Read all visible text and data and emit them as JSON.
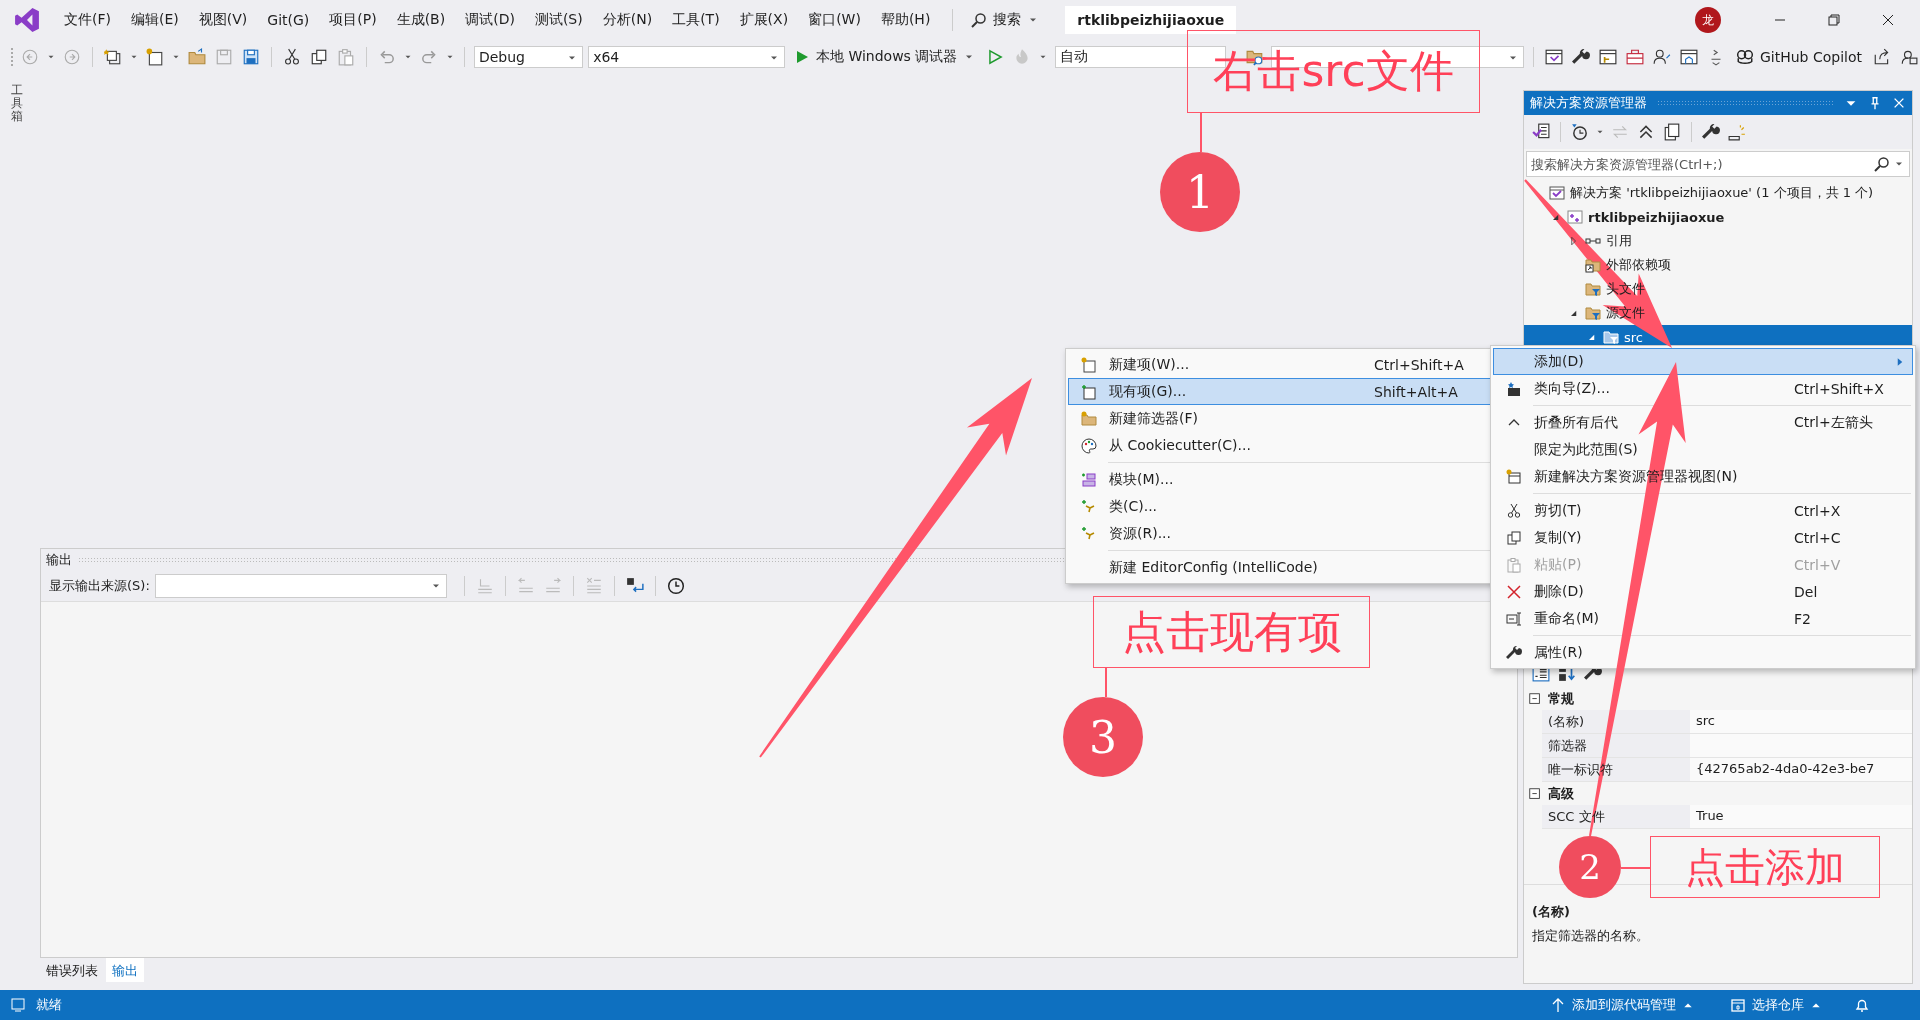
{
  "title_bar": {
    "menus": [
      "文件(F)",
      "编辑(E)",
      "视图(V)",
      "Git(G)",
      "项目(P)",
      "生成(B)",
      "调试(D)",
      "测试(S)",
      "分析(N)",
      "工具(T)",
      "扩展(X)",
      "窗口(W)",
      "帮助(H)"
    ],
    "search": "搜索",
    "solution_name": "rtklibpeizhijiaoxue",
    "avatar": "龙"
  },
  "toolbar": {
    "configuration": "Debug",
    "platform": "x64",
    "run": "本地 Windows 调试器",
    "startup": "自动",
    "copilot": "GitHub Copilot"
  },
  "side_tab": "工具箱",
  "output_panel": {
    "title": "输出",
    "source_label": "显示输出来源(S):",
    "tabs": [
      {
        "label": "错误列表",
        "selected": false
      },
      {
        "label": "输出",
        "selected": true
      }
    ]
  },
  "solution_explorer": {
    "title": "解决方案资源管理器",
    "search": {
      "placeholder": "搜索解决方案资源管理器(Ctrl+;)"
    },
    "tree": [
      {
        "label": "解决方案 'rtklibpeizhijiaoxue' (1 个项目，共 1 个)",
        "kind": "solution",
        "selected": false,
        "children": [
          {
            "label": "rtklibpeizhijiaoxue",
            "kind": "project",
            "expanded": true,
            "selected": false,
            "children": [
              {
                "label": "引用",
                "kind": "references",
                "expanded": false,
                "selected": false
              },
              {
                "label": "外部依赖项",
                "kind": "external",
                "selected": false
              },
              {
                "label": "头文件",
                "kind": "filter",
                "selected": false
              },
              {
                "label": "源文件",
                "kind": "filter",
                "expanded": true,
                "selected": false,
                "children": [
                  {
                    "label": "src",
                    "kind": "filter",
                    "expanded": true,
                    "selected": true
                  }
                ]
              }
            ]
          }
        ]
      }
    ]
  },
  "context_menu": {
    "items": [
      {
        "kind": "item",
        "label": "添加(D)",
        "submenu": true,
        "selected": true,
        "disabled": false
      },
      {
        "kind": "item",
        "label": "类向导(Z)...",
        "shortcut": "Ctrl+Shift+X",
        "selected": false,
        "disabled": false
      },
      {
        "kind": "separator"
      },
      {
        "kind": "item",
        "label": "折叠所有后代",
        "shortcut": "Ctrl+左箭头",
        "selected": false,
        "disabled": false
      },
      {
        "kind": "item",
        "label": "限定为此范围(S)",
        "selected": false,
        "disabled": false
      },
      {
        "kind": "item",
        "label": "新建解决方案资源管理器视图(N)",
        "selected": false,
        "disabled": false
      },
      {
        "kind": "separator"
      },
      {
        "kind": "item",
        "label": "剪切(T)",
        "shortcut": "Ctrl+X",
        "selected": false,
        "disabled": false
      },
      {
        "kind": "item",
        "label": "复制(Y)",
        "shortcut": "Ctrl+C",
        "selected": false,
        "disabled": false
      },
      {
        "kind": "item",
        "label": "粘贴(P)",
        "shortcut": "Ctrl+V",
        "selected": false,
        "disabled": true
      },
      {
        "kind": "item",
        "label": "删除(D)",
        "shortcut": "Del",
        "selected": false,
        "disabled": false
      },
      {
        "kind": "item",
        "label": "重命名(M)",
        "shortcut": "F2",
        "selected": false,
        "disabled": false
      },
      {
        "kind": "separator"
      },
      {
        "kind": "item",
        "label": "属性(R)",
        "selected": false,
        "disabled": false
      }
    ]
  },
  "submenu": {
    "items": [
      {
        "kind": "item",
        "label": "新建项(W)...",
        "shortcut": "Ctrl+Shift+A",
        "selected": false,
        "disabled": false
      },
      {
        "kind": "item",
        "label": "现有项(G)...",
        "shortcut": "Shift+Alt+A",
        "selected": true,
        "disabled": false
      },
      {
        "kind": "item",
        "label": "新建筛选器(F)",
        "selected": false,
        "disabled": false
      },
      {
        "kind": "item",
        "label": "从 Cookiecutter(C)...",
        "selected": false,
        "disabled": false
      },
      {
        "kind": "separator"
      },
      {
        "kind": "item",
        "label": "模块(M)...",
        "selected": false,
        "disabled": false
      },
      {
        "kind": "item",
        "label": "类(C)...",
        "selected": false,
        "disabled": false
      },
      {
        "kind": "item",
        "label": "资源(R)...",
        "selected": false,
        "disabled": false
      },
      {
        "kind": "separator"
      },
      {
        "kind": "item",
        "label": "新建 EditorConfig (IntelliCode)",
        "selected": false,
        "disabled": false
      }
    ]
  },
  "properties": {
    "groups": [
      {
        "label": "常规",
        "expanded": true,
        "rows": [
          {
            "name": "(名称)",
            "value": "src"
          },
          {
            "name": "筛选器"
          },
          {
            "name": "唯一标识符",
            "value": "{42765ab2-4da0-42e3-be7"
          }
        ]
      },
      {
        "label": "高级",
        "expanded": true,
        "rows": [
          {
            "name": "SCC 文件",
            "value": "True"
          }
        ]
      }
    ],
    "description_title": "(名称)",
    "description": "指定筛选器的名称。"
  },
  "status_bar": {
    "status": "就绪",
    "source_control": "添加到源代码管理",
    "repository": "选择仓库"
  },
  "annotations": [
    {
      "number": "1",
      "text": "右击src文件"
    },
    {
      "number": "2",
      "text": "点击添加"
    },
    {
      "number": "3",
      "text": "点击现有项"
    }
  ]
}
